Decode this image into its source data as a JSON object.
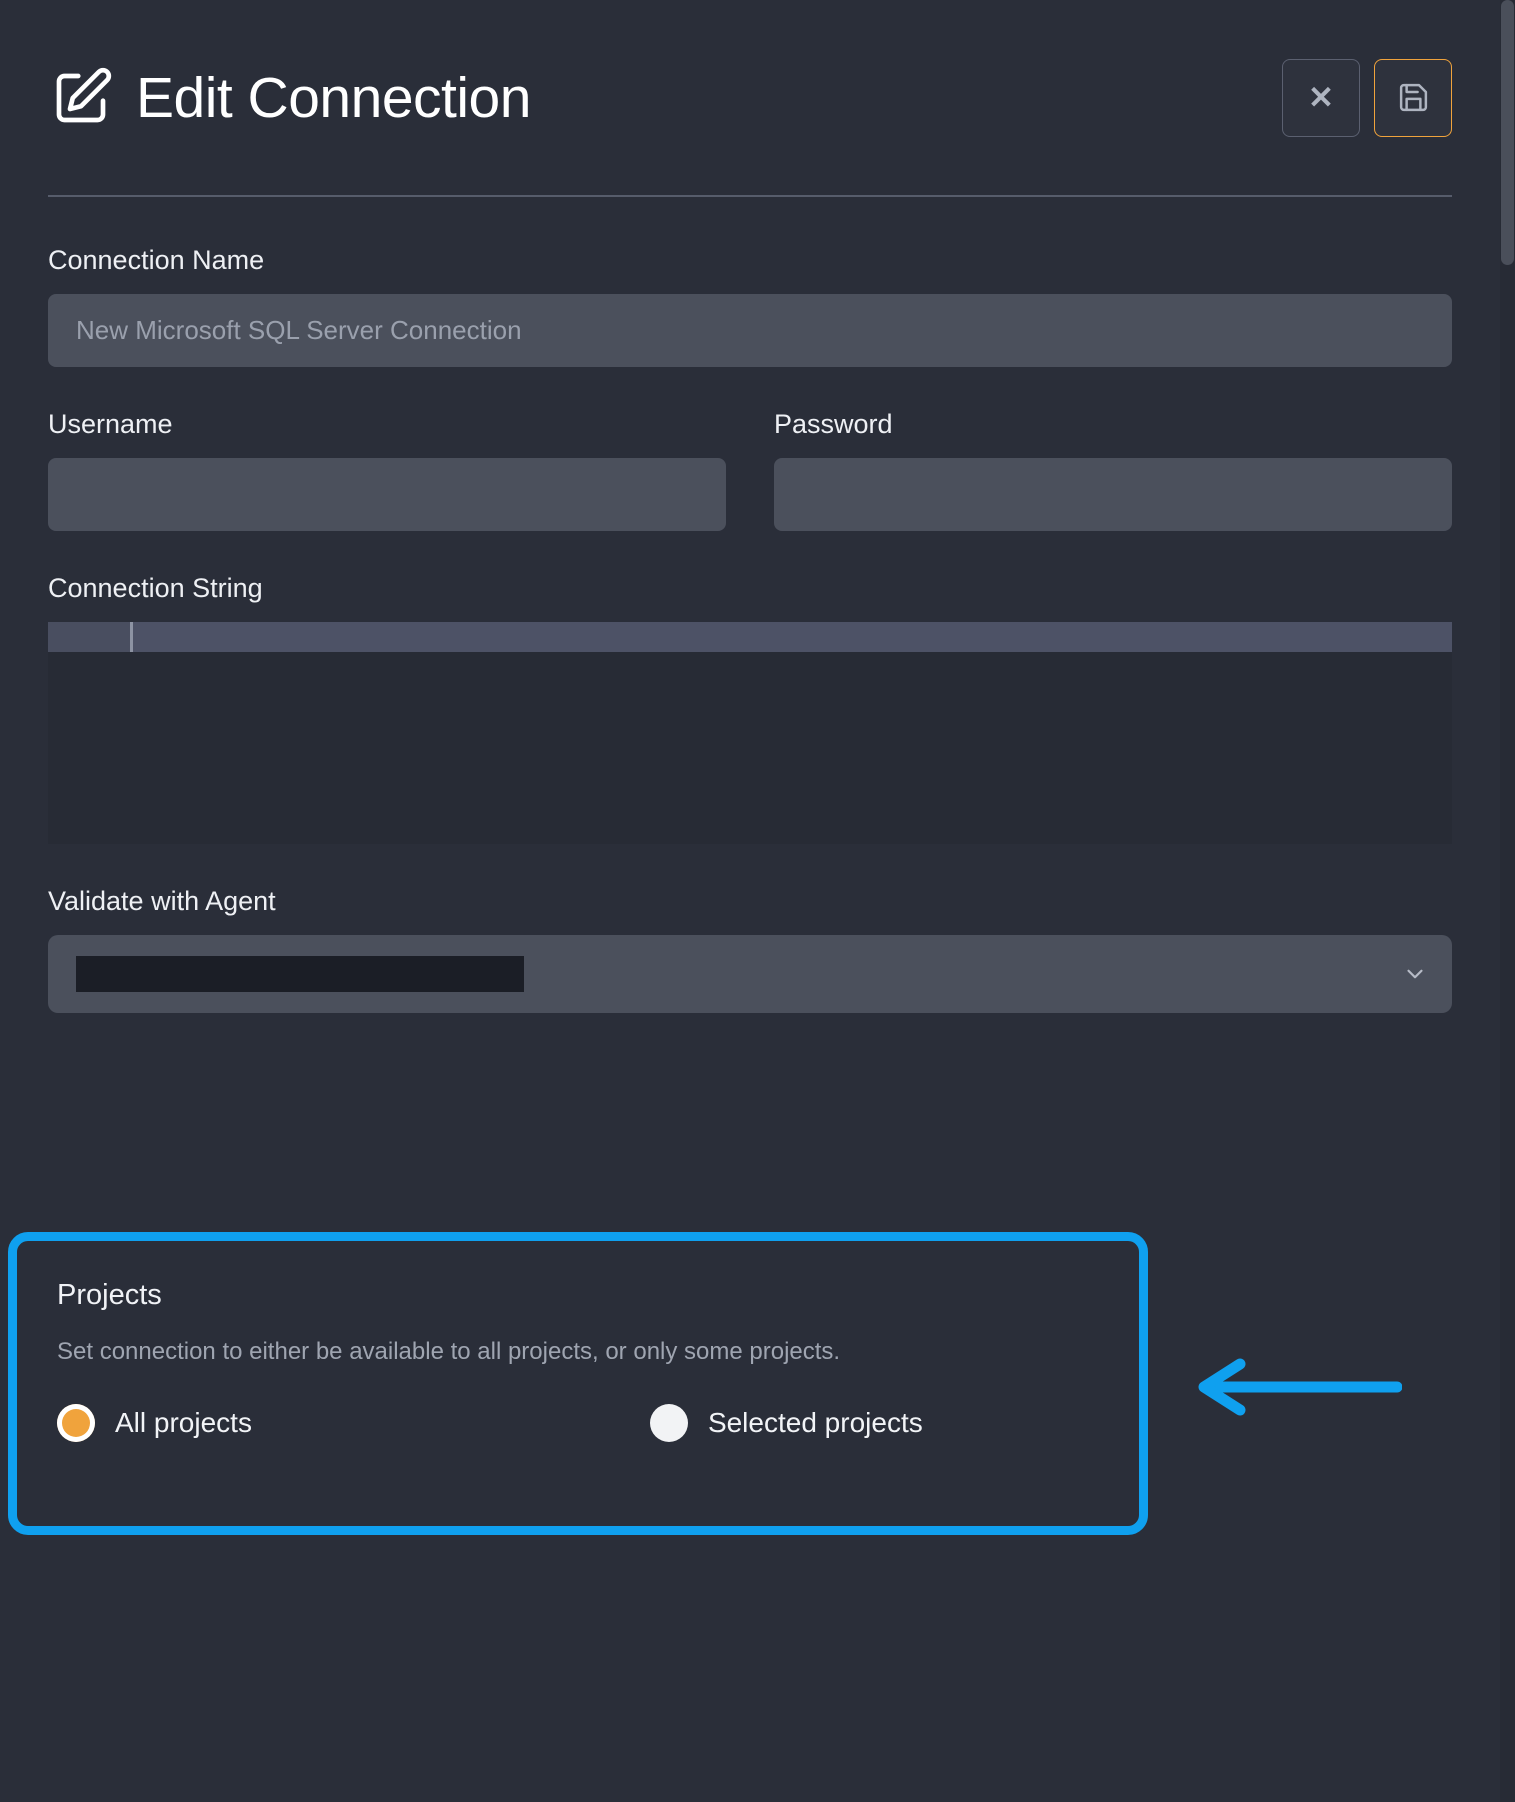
{
  "window": {
    "title": "Edit Connection",
    "title_icon": "edit-square-pencil-icon",
    "background_color": "#2a2e39"
  },
  "header": {
    "title": "Edit Connection",
    "close_button": {
      "icon": "close-x-icon",
      "label": "✕"
    },
    "save_button": {
      "icon": "floppy-disk-save-icon",
      "border_color": "#f0a33c"
    }
  },
  "form": {
    "connection_name": {
      "label": "Connection Name",
      "value": "",
      "placeholder": "New Microsoft SQL Server Connection"
    },
    "username": {
      "label": "Username",
      "value": "",
      "placeholder": ""
    },
    "password": {
      "label": "Password",
      "value": "",
      "placeholder": ""
    },
    "connection_string": {
      "label": "Connection String",
      "value": ""
    },
    "validate_with_agent": {
      "label": "Validate with Agent",
      "value": "",
      "redacted": true,
      "chevron_icon": "chevron-down-icon"
    }
  },
  "projects": {
    "title": "Projects",
    "description": "Set connection to either be available to all projects, or only some projects.",
    "options": [
      {
        "label": "All projects",
        "selected": true
      },
      {
        "label": "Selected projects",
        "selected": false
      }
    ],
    "selected_color": "#f0a33c",
    "highlight_color": "#0fa0ef"
  },
  "annotation": {
    "arrow": "left-pointing-arrow",
    "color": "#0fa0ef"
  },
  "scrollbar": {
    "position": "right",
    "thumb_color": "#4a4f5a"
  }
}
